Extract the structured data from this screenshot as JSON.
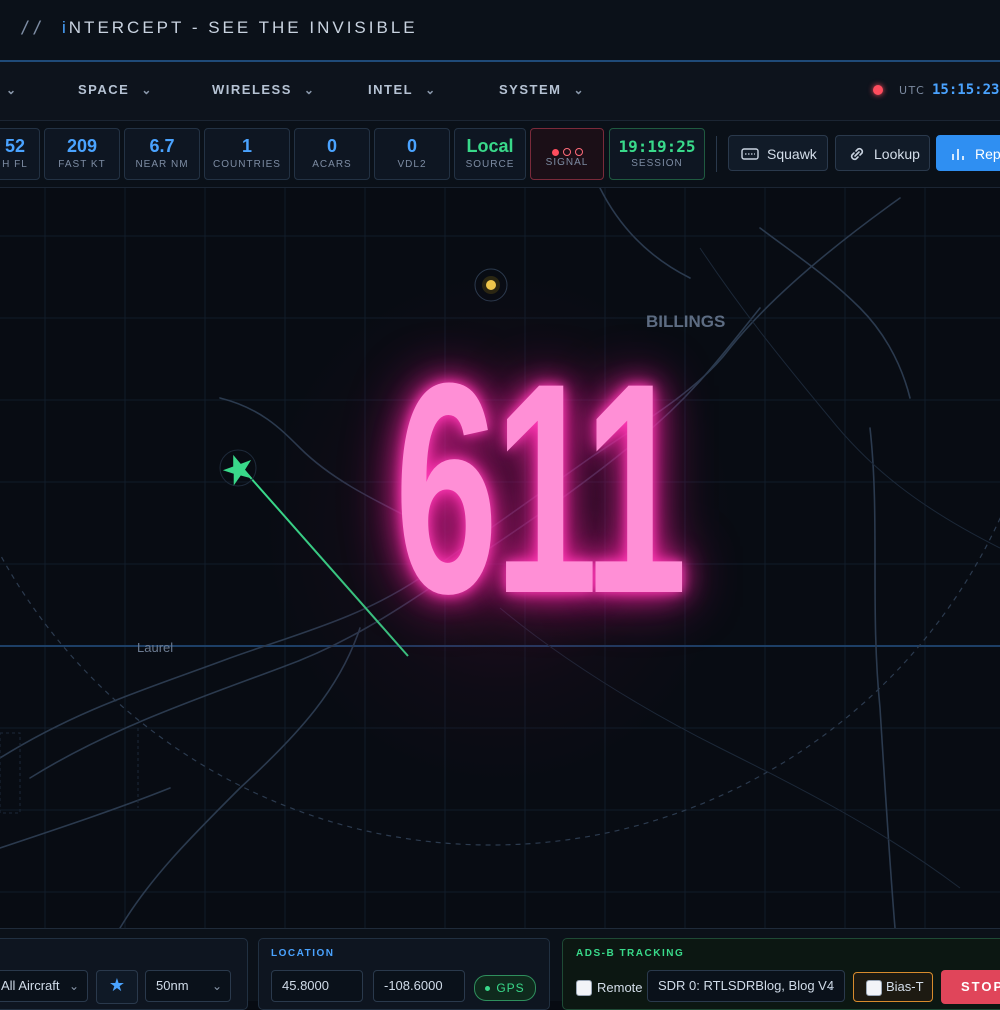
{
  "app": {
    "slashes": "//",
    "title_accent": "i",
    "title_rest": "NTERCEPT - SEE THE INVISIBLE"
  },
  "nav": {
    "items": [
      {
        "label": ""
      },
      {
        "label": "SPACE"
      },
      {
        "label": "WIRELESS"
      },
      {
        "label": "INTEL"
      },
      {
        "label": "SYSTEM"
      }
    ],
    "utc_label": "UTC",
    "utc_time": "15:15:23"
  },
  "stats": [
    {
      "value": "52",
      "label": "H FL"
    },
    {
      "value": "209",
      "label": "FAST KT"
    },
    {
      "value": "6.7",
      "label": "NEAR NM"
    },
    {
      "value": "1",
      "label": "COUNTRIES"
    },
    {
      "value": "0",
      "label": "ACARS"
    },
    {
      "value": "0",
      "label": "VDL2"
    },
    {
      "value": "Local",
      "label": "SOURCE"
    },
    {
      "value": "",
      "label": "SIGNAL"
    },
    {
      "value": "19:19:25",
      "label": "SESSION"
    }
  ],
  "toolbar": {
    "squawk": "Squawk",
    "lookup": "Lookup",
    "report": "Repo"
  },
  "map": {
    "cities": [
      "BILLINGS",
      "Laurel"
    ],
    "overlay_number": "611",
    "track_color": "#39d98a",
    "overlay_color": "#ff8fd6"
  },
  "bottom": {
    "filter": "All Aircraft",
    "range": "50nm",
    "location_title": "LOCATION",
    "lat": "45.8000",
    "lon": "-108.6000",
    "gps": "GPS",
    "adsb_title": "ADS-B TRACKING",
    "remote": "Remote",
    "sdr": "SDR 0: RTLSDRBlog, Blog V4",
    "bias_t": "Bias-T",
    "stop": "STOP"
  },
  "colors": {
    "accent": "#4aa3ff",
    "ok": "#39d98a",
    "alert": "#ff4d5e"
  }
}
